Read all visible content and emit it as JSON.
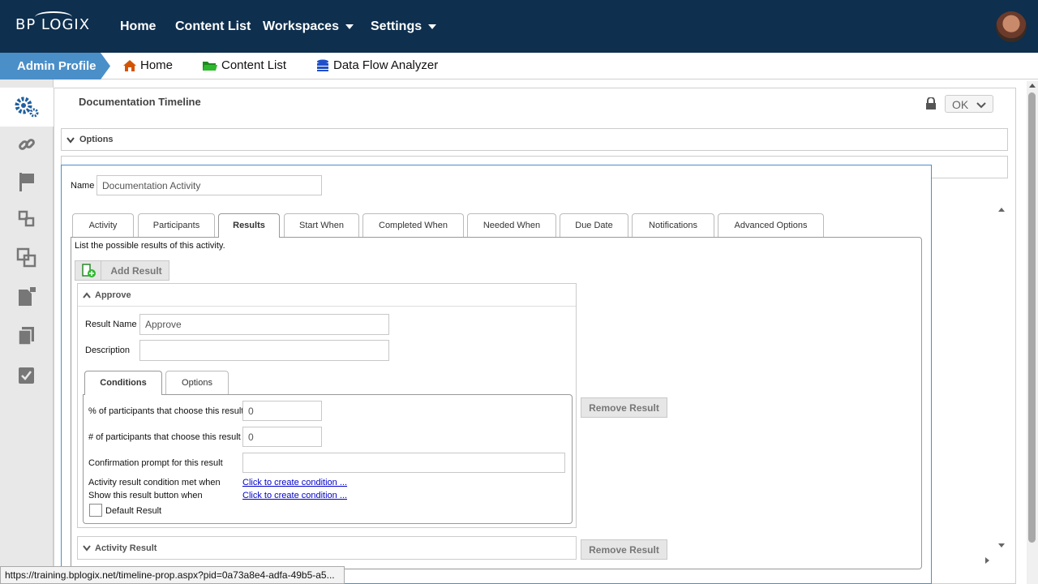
{
  "topbar": {
    "logo": "BP LOGIX",
    "nav": [
      {
        "label": "Home"
      },
      {
        "label": "Content List"
      },
      {
        "label": "Workspaces"
      },
      {
        "label": "Settings"
      }
    ]
  },
  "subbar": {
    "admin": "Admin Profile",
    "crumbs": [
      "Home",
      "Content List",
      "Data Flow Analyzer"
    ]
  },
  "panel": {
    "title": "Documentation Timeline",
    "ok": "OK",
    "options": "Options"
  },
  "dialog": {
    "name_label": "Name",
    "name_value": "Documentation Activity",
    "tabs": [
      "Activity",
      "Participants",
      "Results",
      "Start When",
      "Completed When",
      "Needed When",
      "Due Date",
      "Notifications",
      "Advanced Options"
    ],
    "description": "List the possible results of this activity.",
    "add_result": "Add Result",
    "remove_result": "Remove Result",
    "result1": {
      "header": "Approve",
      "result_name_label": "Result Name",
      "result_name_value": "Approve",
      "description_label": "Description",
      "description_value": "",
      "subtabs": [
        "Conditions",
        "Options"
      ],
      "pct_label": "% of participants that choose this result",
      "pct_value": "0",
      "num_label": "# of participants that choose this result",
      "num_value": "0",
      "confirm_label": "Confirmation prompt for this result",
      "confirm_value": "",
      "cond_met_label": "Activity result condition met when",
      "cond_met_link": "Click to create condition ...",
      "show_btn_label": "Show this result button when",
      "show_btn_link": "Click to create condition ...",
      "default_label": "Default Result"
    },
    "result2": {
      "header": "Activity Result"
    }
  },
  "status": {
    "url": "https://training.bplogix.net/timeline-prop.aspx?pid=0a73a8e4-adfa-49b5-a5..."
  },
  "colors": {
    "topbar": "#0e2f4e",
    "accent": "#4a8fc8"
  }
}
